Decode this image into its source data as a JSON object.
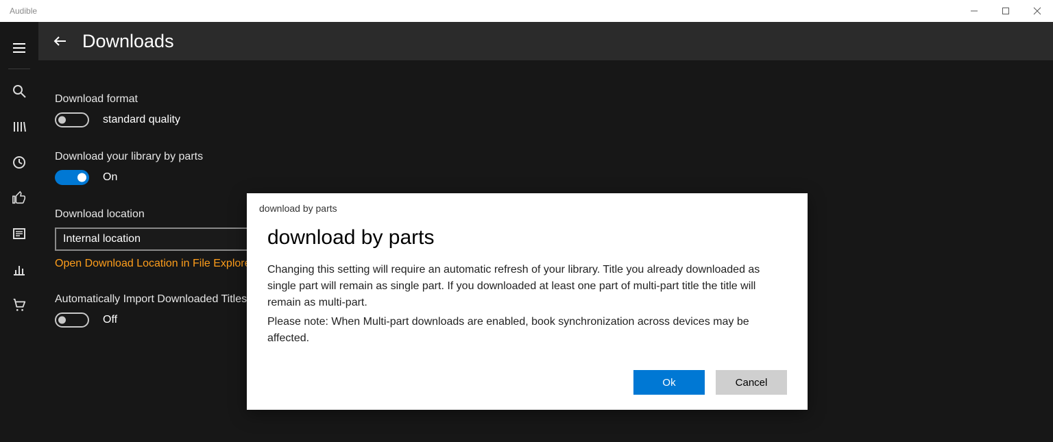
{
  "window": {
    "title": "Audible"
  },
  "header": {
    "page_title": "Downloads"
  },
  "sidebar": {
    "items": [
      "menu",
      "search",
      "library",
      "clock",
      "thumbs-up",
      "news",
      "stats",
      "cart"
    ]
  },
  "settings": {
    "download_format": {
      "label": "Download format",
      "value": "standard quality",
      "state_text": "standard quality",
      "toggle_on": false
    },
    "download_by_parts": {
      "label": "Download your library by parts",
      "state_text": "On",
      "toggle_on": true
    },
    "download_location": {
      "label": "Download location",
      "selected": "Internal location",
      "link": "Open Download Location in File Explorer"
    },
    "auto_import": {
      "label": "Automatically Import Downloaded Titles",
      "state_text": "Off",
      "toggle_on": false
    }
  },
  "dialog": {
    "small_title": "download by parts",
    "title": "download by parts",
    "para1": "Changing this setting will require an automatic refresh of your library. Title you already downloaded as single part will remain as single part. If you downloaded at least one part of multi-part title the title will remain as multi-part.",
    "para2": "Please note: When Multi-part downloads are enabled, book synchronization across devices may be affected.",
    "ok": "Ok",
    "cancel": "Cancel"
  }
}
